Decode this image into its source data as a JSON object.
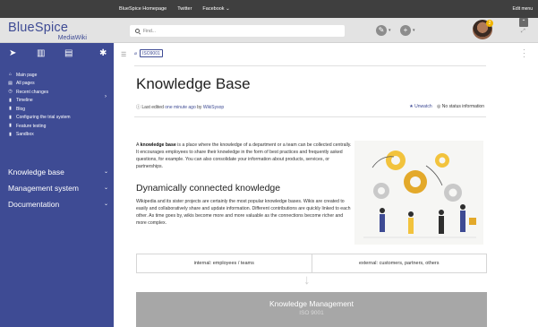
{
  "topbar": {
    "links": [
      "BlueSpice Homepage",
      "Twitter",
      "Facebook ⌄"
    ],
    "edit_menu": "Edit menu"
  },
  "header": {
    "logo_main": "BlueSpice",
    "logo_sub": "MediaWiki",
    "search_placeholder": "Find...",
    "notification_count": "2"
  },
  "sidebar": {
    "nav_items": [
      {
        "icon": "home-icon",
        "label": "Main page"
      },
      {
        "icon": "list-icon",
        "label": "All pages"
      },
      {
        "icon": "clock-icon",
        "label": "Recent changes"
      },
      {
        "icon": "file-icon",
        "label": "Timeline"
      },
      {
        "icon": "file-icon",
        "label": "Blog"
      },
      {
        "icon": "file-icon",
        "label": "Configuring the trial system"
      },
      {
        "icon": "file-icon",
        "label": "Feature testing"
      },
      {
        "icon": "file-icon",
        "label": "Sandbox"
      }
    ],
    "sections": [
      "Knowledge base",
      "Management system",
      "Documentation"
    ],
    "accent_color": "#3e4b94"
  },
  "content": {
    "breadcrumb_tag": "ISO9001",
    "title": "Knowledge Base",
    "meta_prefix": "Last edited",
    "meta_time": "one minute ago",
    "meta_by": "by",
    "meta_user": "WikiSysop",
    "unwatch": "Unwatch",
    "status": "No status information",
    "intro_bold": "knowledge base",
    "intro_pre": "A",
    "intro_rest": " is a place where the knowledge of a department or a team can be collected centrally. It encourages employees to share their knowledge in the form of best practices and frequently asked questions, for example. You can also consolidate your information about products, services, or partnerships.",
    "h2": "Dynamically connected knowledge",
    "para2": "Wikipedia and its sister projects are certainly the most popular knowledge bases. Wikis are created to easily and collaboratively share and update information. Different contributions are quickly linked to each other. As time goes by, wikis become more and more valuable as the connections become richer and more complex.",
    "col_left": "internal: employees / teams",
    "col_right": "external: customers, partners, others",
    "km_title": "Knowledge Management",
    "km_sub": "ISO 9001"
  }
}
